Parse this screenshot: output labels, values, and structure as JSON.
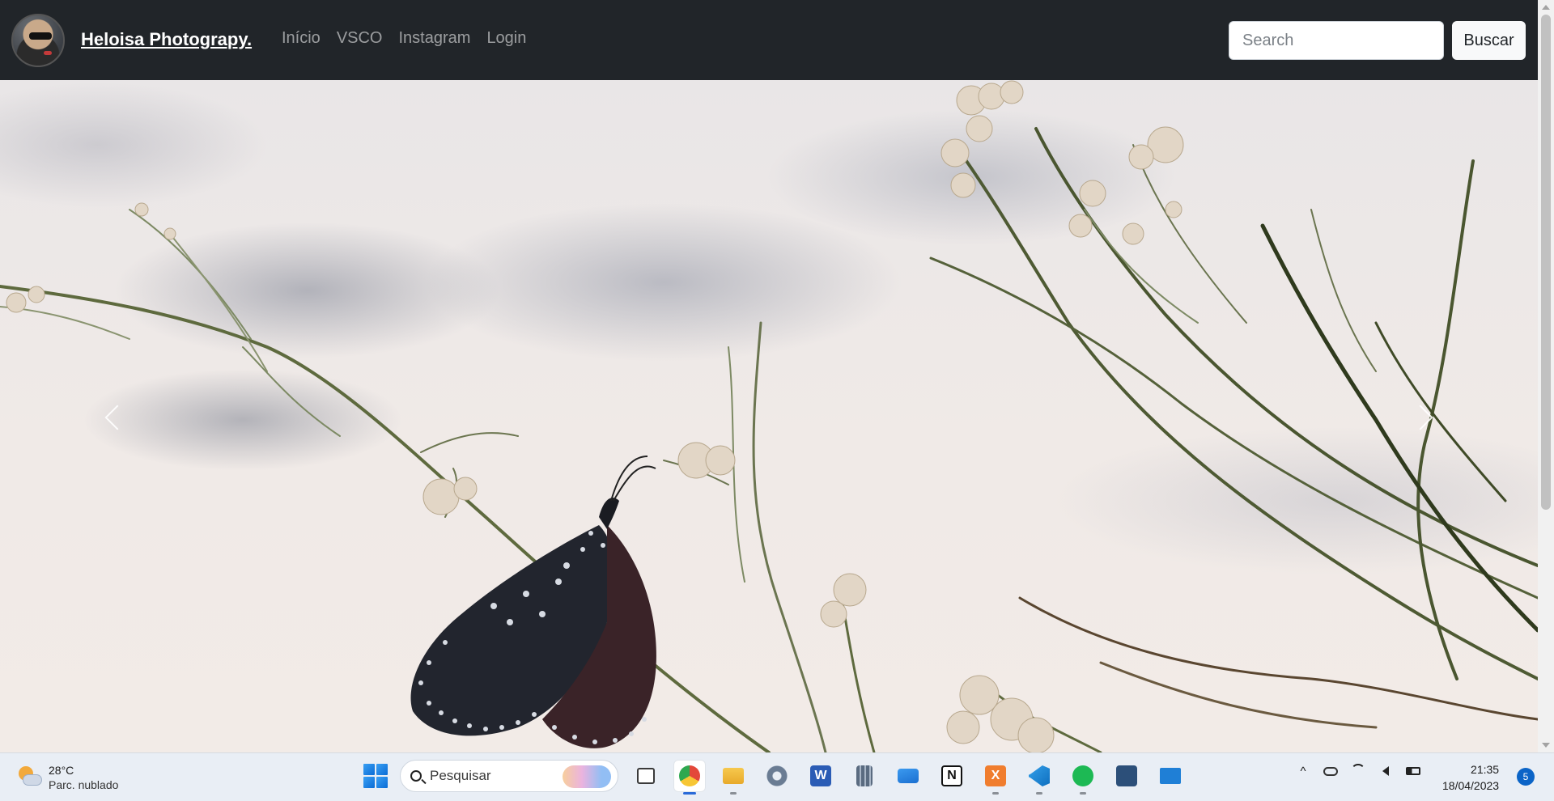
{
  "navbar": {
    "brand": "Heloisa Photograpy.",
    "links": [
      "Início",
      "VSCO",
      "Instagram",
      "Login"
    ],
    "search_placeholder": "Search",
    "search_button": "Buscar"
  },
  "carousel": {
    "prev_icon": "chevron-left-icon",
    "next_icon": "chevron-right-icon"
  },
  "taskbar": {
    "weather": {
      "temp": "28°C",
      "desc": "Parc. nublado",
      "icon": "partly-cloudy-icon"
    },
    "search_label": "Pesquisar",
    "apps": [
      {
        "name": "task-view",
        "icon": "task-view-icon",
        "color": "#3a3a3a"
      },
      {
        "name": "chrome",
        "icon": "chrome-icon",
        "color": "#e3483a",
        "active": true
      },
      {
        "name": "file-explorer",
        "icon": "folder-icon",
        "color": "#f3b93b"
      },
      {
        "name": "settings",
        "icon": "gear-icon",
        "color": "#6a7c93"
      },
      {
        "name": "word",
        "icon": "word-icon",
        "color": "#2b5cb5"
      },
      {
        "name": "calculator",
        "icon": "calculator-icon",
        "color": "#5a6b80"
      },
      {
        "name": "mail",
        "icon": "mail-icon",
        "color": "#1b78d6"
      },
      {
        "name": "notion",
        "icon": "notion-icon",
        "color": "#111111"
      },
      {
        "name": "xampp",
        "icon": "xampp-icon",
        "color": "#f07d2e"
      },
      {
        "name": "vscode",
        "icon": "vscode-icon",
        "color": "#1f8ad2"
      },
      {
        "name": "spotify",
        "icon": "spotify-icon",
        "color": "#1db954"
      },
      {
        "name": "mysql-workbench",
        "icon": "database-icon",
        "color": "#2c4f79"
      },
      {
        "name": "remote-desktop",
        "icon": "monitor-icon",
        "color": "#1f7fd6"
      }
    ],
    "tray": {
      "chevron": "^",
      "clock_time": "21:35",
      "clock_date": "18/04/2023",
      "notifications": "5"
    }
  }
}
